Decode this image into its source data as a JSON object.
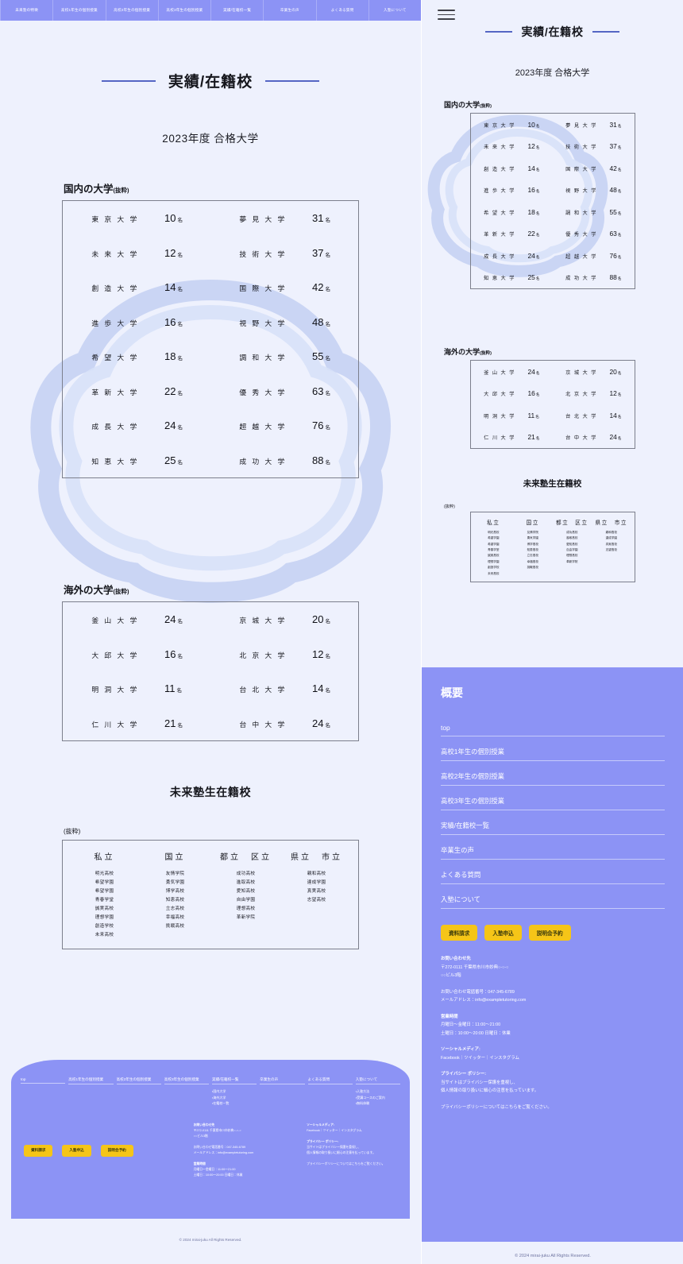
{
  "site": {
    "page_title": "実績/在籍校",
    "year_heading": "2023年度 合格大学",
    "copyright": "© 2024 mirai-juku All Rights Reserved."
  },
  "topnav": {
    "items": [
      "未来塾の特徴",
      "高校1年生の個別授業",
      "高校2年生の個別授業",
      "高校3年生の個別授業",
      "実績/在籍校一覧",
      "卒業生の声",
      "よくある質問",
      "入塾について"
    ]
  },
  "domestic": {
    "heading": "国内の大学",
    "heading_note": "(抜粋)",
    "unit": "名",
    "left": [
      {
        "name": "東 京 大 学",
        "count": "10"
      },
      {
        "name": "未 来 大 学",
        "count": "12"
      },
      {
        "name": "創 造 大 学",
        "count": "14"
      },
      {
        "name": "進 歩 大 学",
        "count": "16"
      },
      {
        "name": "希 望 大 学",
        "count": "18"
      },
      {
        "name": "革 新 大 学",
        "count": "22"
      },
      {
        "name": "成 長 大 学",
        "count": "24"
      },
      {
        "name": "知 恵 大 学",
        "count": "25"
      }
    ],
    "right": [
      {
        "name": "夢 見 大 学",
        "count": "31"
      },
      {
        "name": "技 術 大 学",
        "count": "37"
      },
      {
        "name": "国 際 大 学",
        "count": "42"
      },
      {
        "name": "視 野 大 学",
        "count": "48"
      },
      {
        "name": "調 和 大 学",
        "count": "55"
      },
      {
        "name": "優 秀 大 学",
        "count": "63"
      },
      {
        "name": "超 越 大 学",
        "count": "76"
      },
      {
        "name": "成 功 大 学",
        "count": "88"
      }
    ]
  },
  "overseas": {
    "heading": "海外の大学",
    "heading_note": "(抜粋)",
    "unit": "名",
    "left": [
      {
        "name": "釜 山 大 学",
        "count": "24"
      },
      {
        "name": "大 邱 大 学",
        "count": "16"
      },
      {
        "name": "明 洞 大 学",
        "count": "11"
      },
      {
        "name": "仁 川 大 学",
        "count": "21"
      }
    ],
    "right": [
      {
        "name": "京 城 大 学",
        "count": "20"
      },
      {
        "name": "北 京 大 学",
        "count": "12"
      },
      {
        "name": "台 北 大 学",
        "count": "14"
      },
      {
        "name": "台 中 大 学",
        "count": "24"
      }
    ]
  },
  "highschools": {
    "title": "未来塾生在籍校",
    "note": "(抜粋)",
    "columns": [
      {
        "header": "私立",
        "items": [
          "明光高校",
          "希望学園",
          "希望学園",
          "青春学堂",
          "誠実高校",
          "理想学園",
          "創造学校",
          "未来高校"
        ]
      },
      {
        "header": "国立",
        "items": [
          "友情学院",
          "勇気学園",
          "博学高校",
          "知恵高校",
          "立志高校",
          "幸福高校",
          "挑戦高校"
        ]
      },
      {
        "header": "都立　区立",
        "items": [
          "成功高校",
          "進取高校",
          "愛知高校",
          "自由学園",
          "理想高校",
          "革新学院"
        ]
      },
      {
        "header": "県立　市立",
        "items": [
          "親和高校",
          "達成学園",
          "真実高校",
          "志望高校"
        ]
      }
    ]
  },
  "footer": {
    "heading": "概要",
    "nav": [
      {
        "label": "top",
        "subs": []
      },
      {
        "label": "高校1年生の個別授業",
        "subs": []
      },
      {
        "label": "高校2年生の個別授業",
        "subs": []
      },
      {
        "label": "高校3年生の個別授業",
        "subs": []
      },
      {
        "label": "実績/在籍校一覧",
        "subs": [
          "国内大学",
          "海外大学",
          "在籍校一覧"
        ]
      },
      {
        "label": "卒業生の声",
        "subs": []
      },
      {
        "label": "よくある質問",
        "subs": []
      },
      {
        "label": "入塾について",
        "subs": [
          "入塾方法",
          "受講コースのご案内",
          "無料体験"
        ]
      }
    ],
    "buttons": [
      "資料請求",
      "入塾申込",
      "説明会予約"
    ],
    "contact": {
      "title": "お問い合わせ先",
      "address1": "〒272-0111 千葉県市川市妙典○-○-○",
      "address2": "○○ビル3階",
      "tel": "お問い合わせ電話番号：047-345-6789",
      "mail": "メールアドレス：info@exampletutoring.com",
      "hours_title": "営業時間",
      "hours1": "月曜日〜金曜日：11:00〜21:00",
      "hours2": "土曜日：10:00〜20:00 日曜日：休業"
    },
    "social": {
      "title": "ソーシャルメディア:",
      "links": "Facebook｜ツイッター｜インスタグラム",
      "privacy_title": "プライバシー ポリシー:",
      "privacy1": "当サイトはプライバシー保護を重視し、",
      "privacy2": "個人情報の取り扱いに細心の注意を払っています。",
      "privacy3": "プライバシーポリシーについてはこちらをご覧ください。"
    }
  },
  "colors": {
    "brand": "#8c93f5",
    "page_bg": "#eef1fd",
    "accent_line": "#5566c4",
    "button": "#f5c518"
  }
}
